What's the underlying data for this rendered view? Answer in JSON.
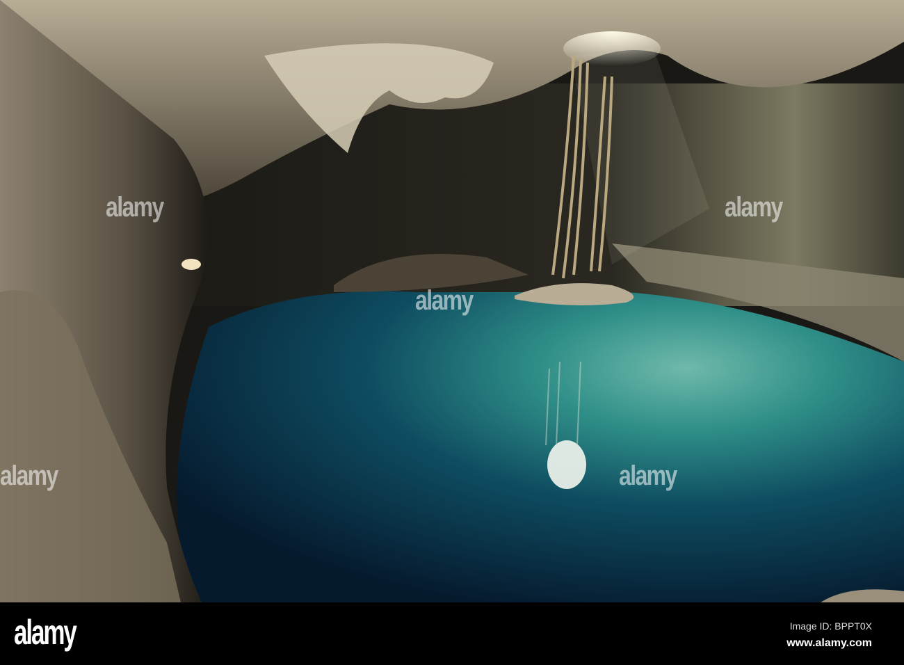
{
  "photo": {
    "subject": "Cenote cave with turquoise water and hanging roots",
    "watermark_text": "alamy",
    "colors": {
      "water_deep": "#0a2740",
      "water_light": "#2f8f88",
      "rock": "#a89a80",
      "shadow": "#15130f"
    }
  },
  "footer": {
    "logo": "alamy",
    "image_id": "Image ID: BPPT0X",
    "url": "www.alamy.com"
  }
}
